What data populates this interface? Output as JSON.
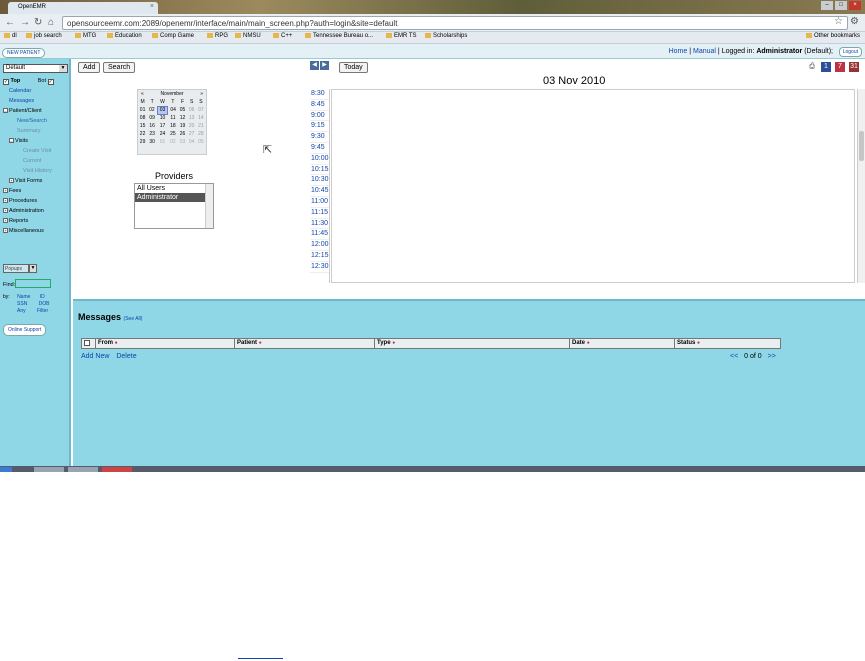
{
  "browser": {
    "tab_title": "OpenEMR",
    "url": "opensourceemr.com:2089/openemr/interface/main/main_screen.php?auth=login&site=default",
    "bookmarks": [
      "dl",
      "job search",
      "MTG",
      "Education",
      "Comp Game",
      "RPG",
      "NMSU",
      "C++",
      "Tennessee Bureau o...",
      "EMR TS",
      "Scholarships"
    ],
    "other_bookmarks": "Other bookmarks"
  },
  "header": {
    "new_patient": "NEW PATIENT",
    "home": "Home",
    "manual": "Manual",
    "logged_in_label": "Logged in:",
    "user": "Administrator",
    "group": "(Default);",
    "logout": "Logout"
  },
  "nav": {
    "select_value": "Default",
    "top_label": "Top",
    "bot_label": "Bot",
    "items": {
      "calendar": "Calendar",
      "messages": "Messages",
      "patient_client": "Patient/Client",
      "new_search": "New/Search",
      "summary": "Summary",
      "visits": "Visits",
      "create_visit": "Create Visit",
      "current": "Current",
      "visit_history": "Visit History",
      "visit_forms": "Visit Forms",
      "fees": "Fees",
      "procedures": "Procedures",
      "administration": "Administration",
      "reports": "Reports",
      "miscellaneous": "Miscellaneous"
    },
    "popups": "Popups",
    "find": "Find:",
    "by": "by:",
    "by_name": "Name",
    "by_id": "ID",
    "by_ssn": "SSN",
    "by_dob": "DOB",
    "by_any": "Any",
    "by_filter": "Filter",
    "online_support": "Online Support"
  },
  "calendar": {
    "add_button": "Add",
    "search_button": "Search",
    "today_button": "Today",
    "month": "November",
    "prev": "«",
    "next": "»",
    "weekdays": [
      "M",
      "T",
      "W",
      "T",
      "F",
      "S",
      "S"
    ],
    "weeks": [
      [
        "01",
        "02",
        "03",
        "04",
        "05",
        "06",
        "07"
      ],
      [
        "08",
        "09",
        "10",
        "11",
        "12",
        "13",
        "14"
      ],
      [
        "15",
        "16",
        "17",
        "18",
        "19",
        "20",
        "21"
      ],
      [
        "22",
        "23",
        "24",
        "25",
        "26",
        "27",
        "28"
      ],
      [
        "29",
        "30",
        "01",
        "02",
        "03",
        "04",
        "05"
      ]
    ],
    "selected_day": "03",
    "providers_title": "Providers",
    "providers": [
      "All Users",
      "Administrator"
    ],
    "selected_provider": "Administrator",
    "date_title": "03 Nov 2010",
    "times": [
      "8:30",
      "8:45",
      "9:00",
      "9:15",
      "9:30",
      "9:45",
      "10:00",
      "10:15",
      "10:30",
      "10:45",
      "11:00",
      "11:15",
      "11:30",
      "11:45",
      "12:00",
      "12:15",
      "12:30"
    ]
  },
  "messages": {
    "title": "Messages",
    "see_all": "(See All)",
    "columns": [
      "From",
      "Patient",
      "Type",
      "Date",
      "Status"
    ],
    "add_new": "Add New",
    "delete": "Delete",
    "pager_prev": "<<",
    "pager_text": "0 of 0",
    "pager_next": ">>"
  }
}
